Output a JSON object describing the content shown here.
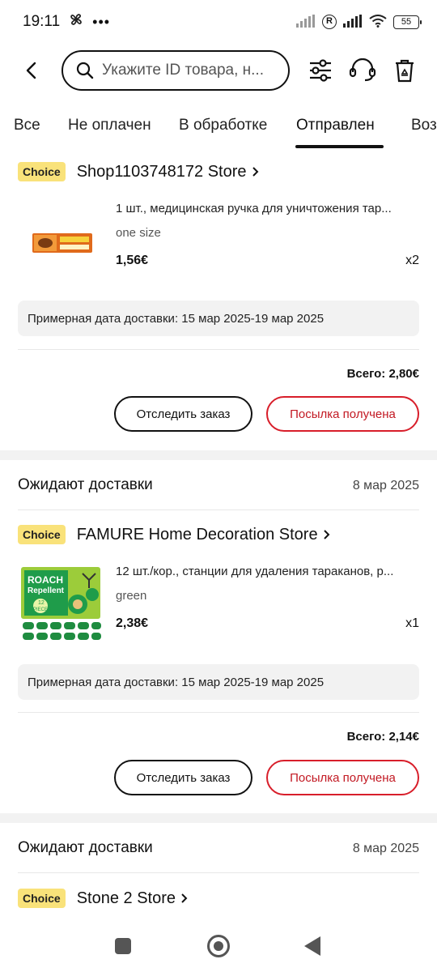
{
  "status_bar": {
    "time": "19:11",
    "battery": "55",
    "r_badge": "R"
  },
  "header": {
    "search_placeholder": "Укажите ID товара, н..."
  },
  "tabs": [
    {
      "label": "Все"
    },
    {
      "label": "Не оплачен"
    },
    {
      "label": "В обработке"
    },
    {
      "label": "Отправлен",
      "active": true
    },
    {
      "label": "Воз"
    }
  ],
  "orders": [
    {
      "badge": "Choice",
      "store": "Shop1103748172 Store",
      "product_title": "1 шт., медицинская ручка для уничтожения тар...",
      "variant": "one size",
      "price": "1,56€",
      "qty": "x2",
      "delivery": "Примерная дата доставки: 15 мар 2025-19 мар 2025",
      "total": "Всего: 2,80€",
      "track_label": "Отследить заказ",
      "received_label": "Посылка получена"
    },
    {
      "group_title": "Ожидают доставки",
      "group_date": "8 мар 2025",
      "badge": "Choice",
      "store": "FAMURE Home Decoration Store",
      "product_title": "12 шт./кор., станции для удаления тараканов, р...",
      "variant": "green",
      "price": "2,38€",
      "qty": "x1",
      "delivery": "Примерная дата доставки: 15 мар 2025-19 мар 2025",
      "total": "Всего: 2,14€",
      "track_label": "Отследить заказ",
      "received_label": "Посылка получена",
      "image_text": {
        "line1": "ROACH",
        "line2": "Repellent",
        "line3": "12",
        "line4": "PIECES"
      }
    },
    {
      "group_title": "Ожидают доставки",
      "group_date": "8 мар 2025",
      "badge": "Choice",
      "store": "Stone 2 Store"
    }
  ],
  "colors": {
    "accent_red": "#d81e2a",
    "choice_yellow": "#f9e27a",
    "roach_green": "#1f9c4a"
  }
}
